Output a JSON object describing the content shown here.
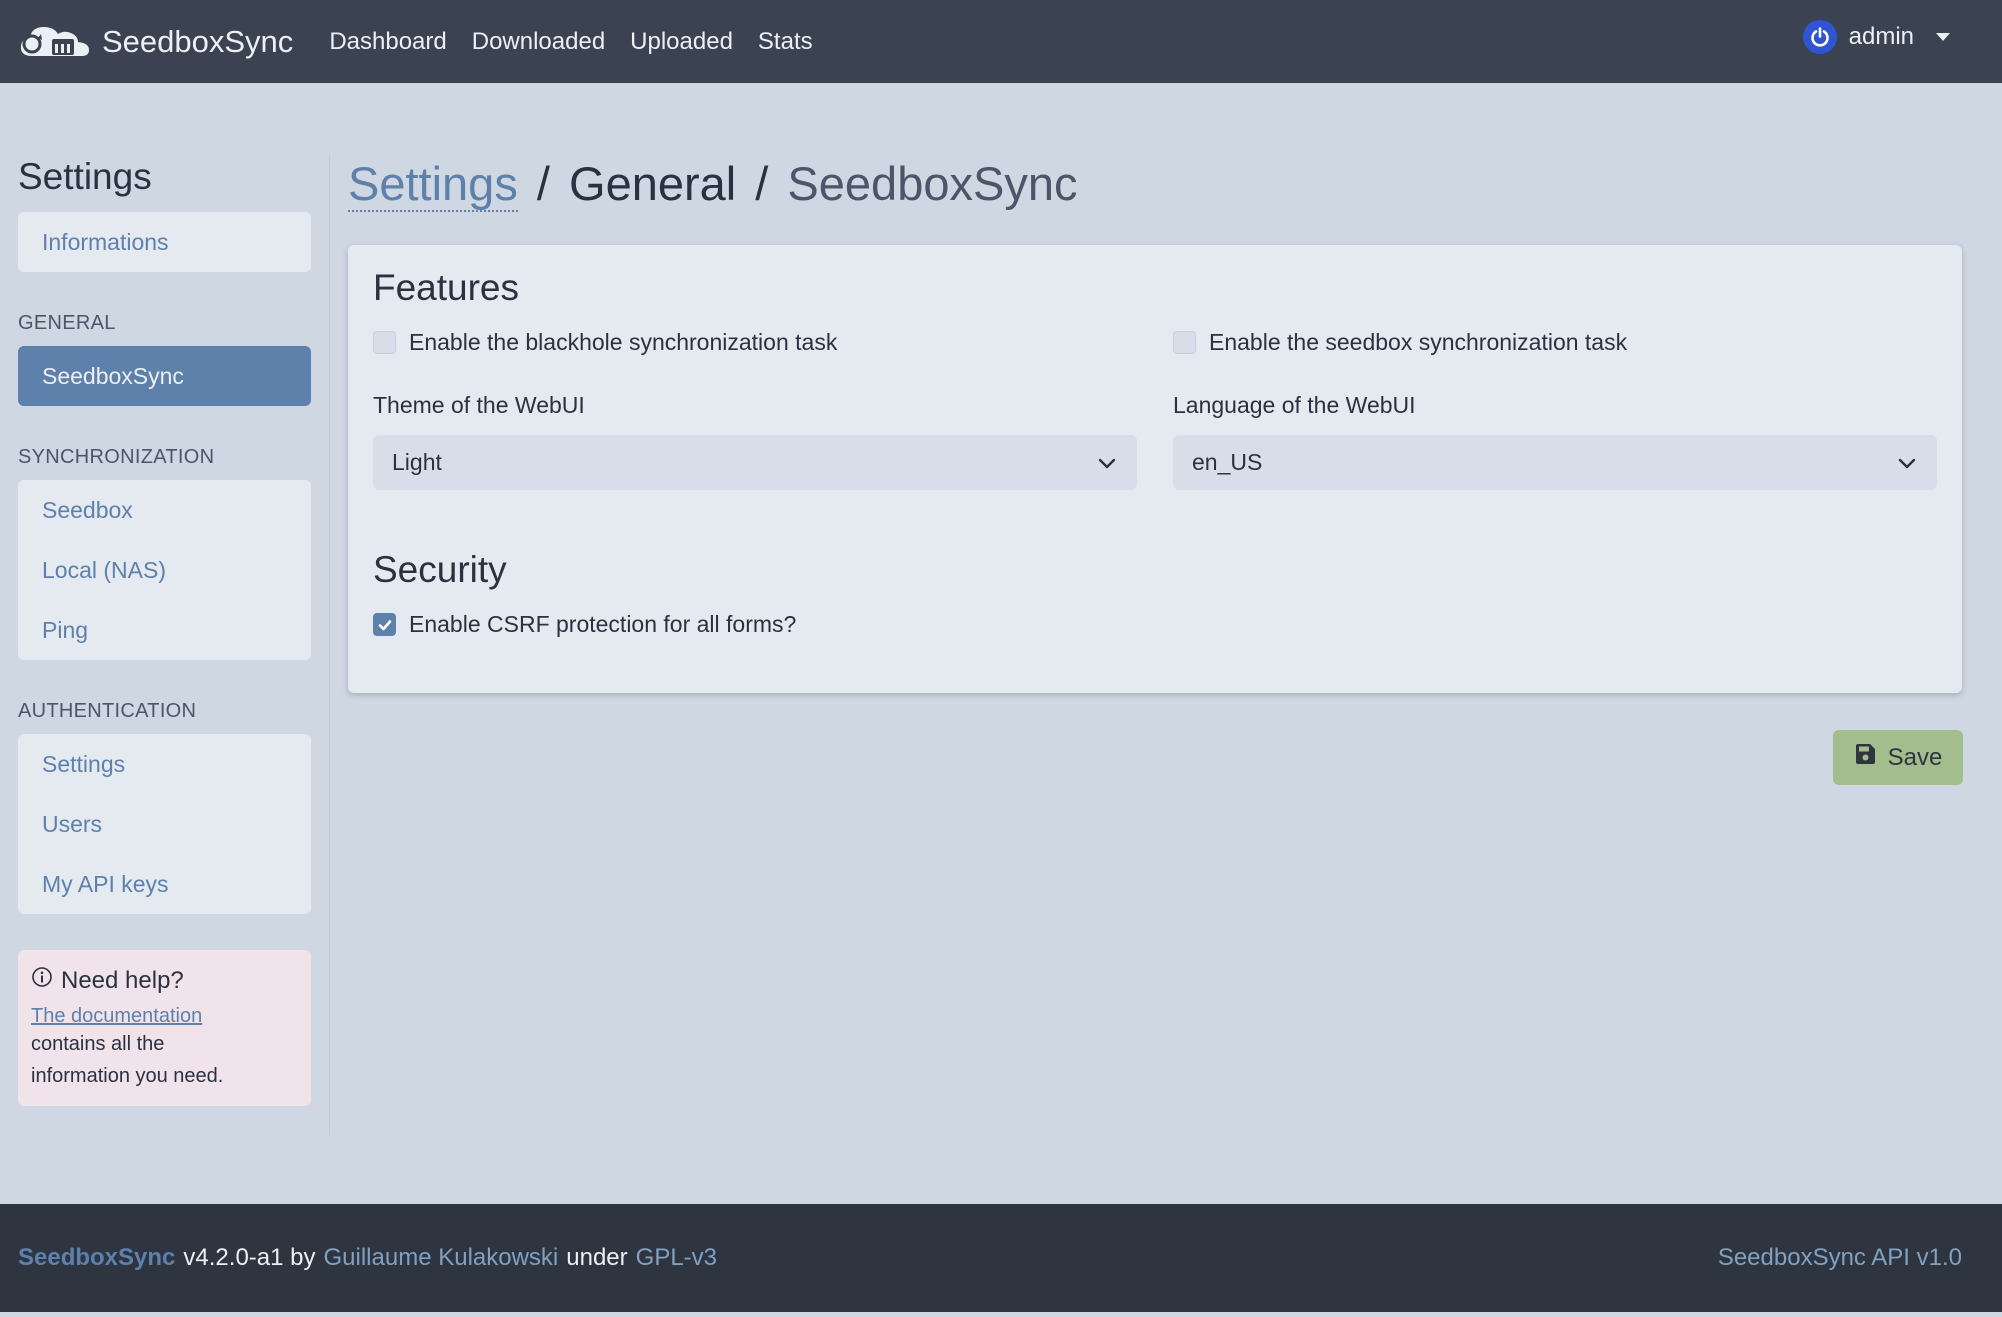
{
  "app": {
    "brand": "SeedboxSync",
    "nav": [
      "Dashboard",
      "Downloaded",
      "Uploaded",
      "Stats"
    ],
    "user": "admin"
  },
  "sidebar": {
    "title": "Settings",
    "informations": "Informations",
    "general_head": "GENERAL",
    "general_item": "SeedboxSync",
    "sync_head": "SYNCHRONIZATION",
    "sync_items": [
      "Seedbox",
      "Local (NAS)",
      "Ping"
    ],
    "auth_head": "AUTHENTICATION",
    "auth_items": [
      "Settings",
      "Users",
      "My API keys"
    ],
    "help": {
      "title": "Need help?",
      "link": "The documentation",
      "text_1": "contains all the",
      "text_2": "information you need."
    }
  },
  "breadcrumb": {
    "root": "Settings",
    "sep": "/",
    "section": "General",
    "page": "SeedboxSync"
  },
  "features": {
    "title": "Features",
    "blackhole_label": "Enable the blackhole synchronization task",
    "blackhole_checked": false,
    "seedbox_label": "Enable the seedbox synchronization task",
    "seedbox_checked": false,
    "theme_label": "Theme of the WebUI",
    "theme_value": "Light",
    "language_label": "Language of the WebUI",
    "language_value": "en_US"
  },
  "security": {
    "title": "Security",
    "csrf_label": "Enable CSRF protection for all forms?",
    "csrf_checked": true
  },
  "save_label": "Save",
  "footer": {
    "brand": "SeedboxSync",
    "version": "v4.2.0-a1 by",
    "author": "Guillaume Kulakowski",
    "under": "under",
    "license": "GPL-v3",
    "api": "SeedboxSync API v1.0"
  },
  "colors": {
    "navbar": "#3b4252",
    "background": "#cfd7e3",
    "accent": "#5e81ac",
    "save": "#a3be8c",
    "footer": "#2e3440"
  }
}
